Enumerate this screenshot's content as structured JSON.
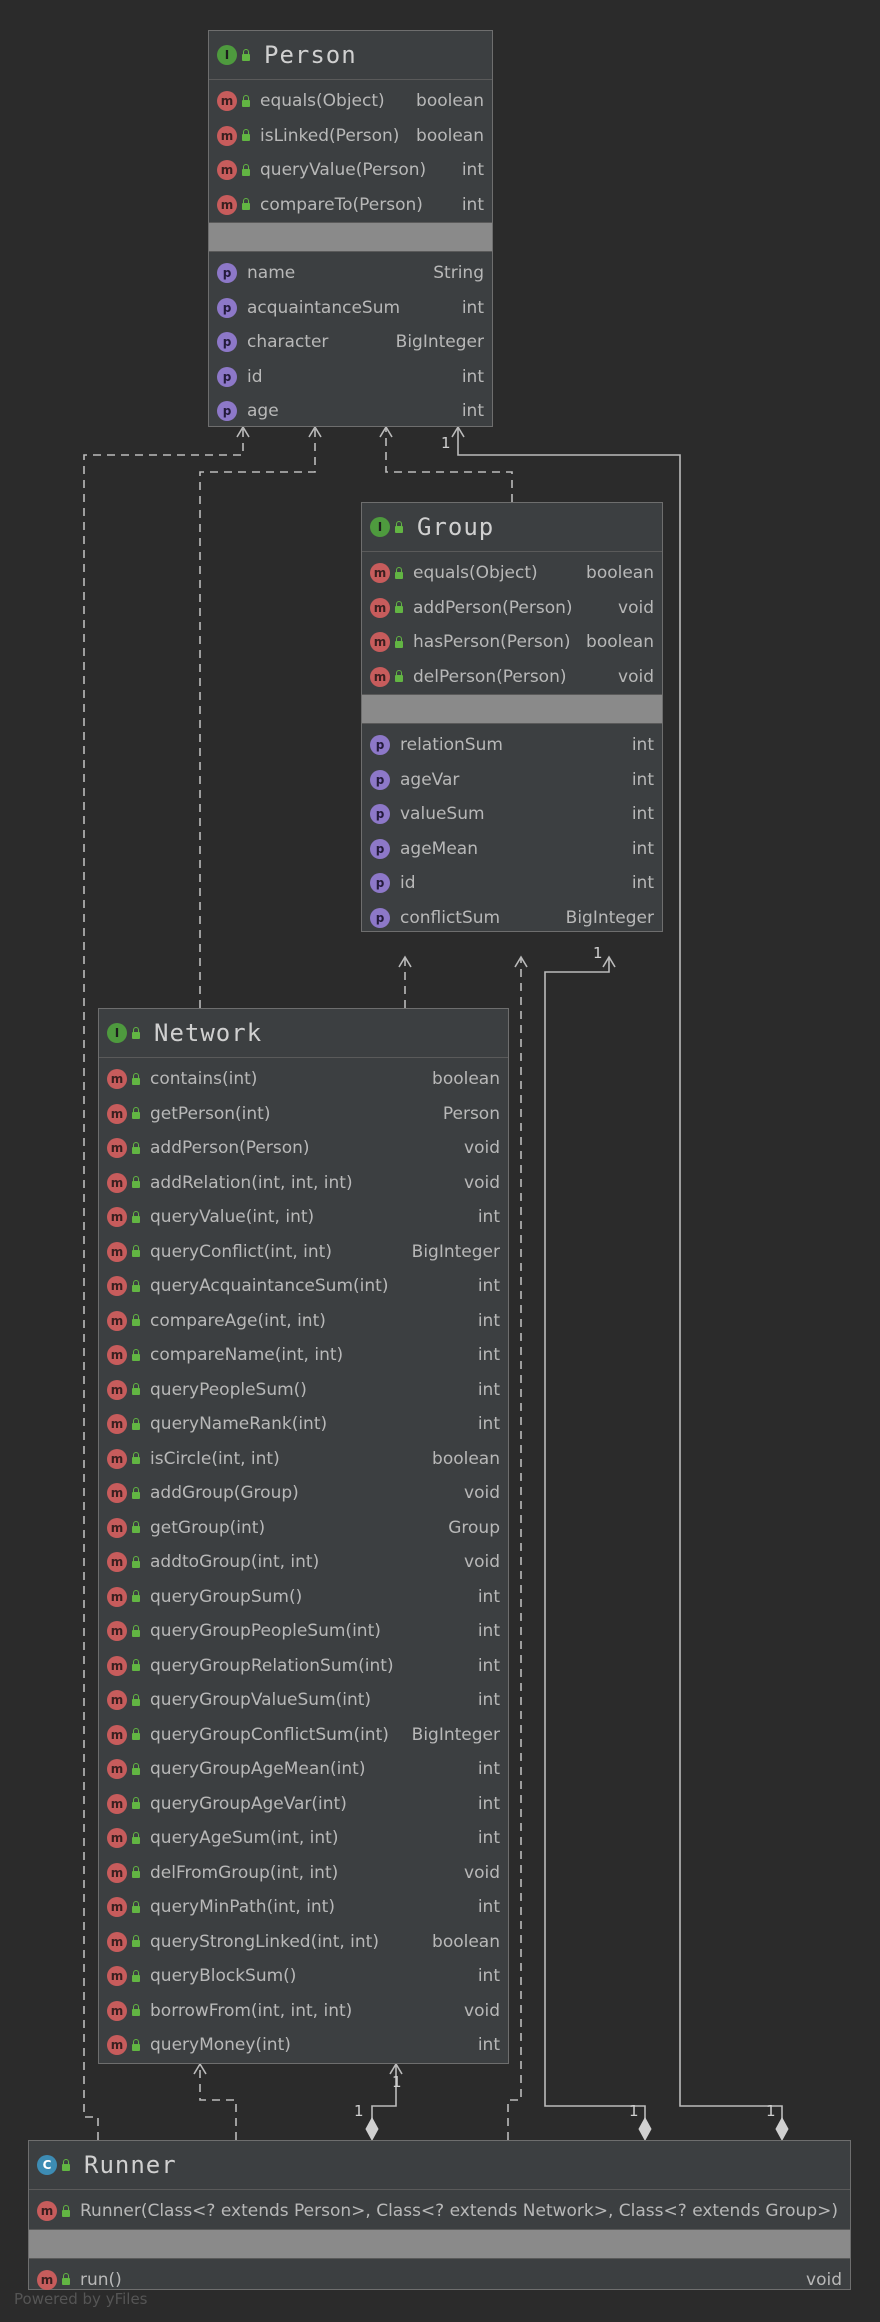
{
  "person": {
    "title": "Person",
    "methods": [
      {
        "name": "equals(Object)",
        "type": "boolean"
      },
      {
        "name": "isLinked(Person)",
        "type": "boolean"
      },
      {
        "name": "queryValue(Person)",
        "type": "int"
      },
      {
        "name": "compareTo(Person)",
        "type": "int"
      }
    ],
    "properties": [
      {
        "name": "name",
        "type": "String"
      },
      {
        "name": "acquaintanceSum",
        "type": "int"
      },
      {
        "name": "character",
        "type": "BigInteger"
      },
      {
        "name": "id",
        "type": "int"
      },
      {
        "name": "age",
        "type": "int"
      }
    ]
  },
  "group": {
    "title": "Group",
    "methods": [
      {
        "name": "equals(Object)",
        "type": "boolean"
      },
      {
        "name": "addPerson(Person)",
        "type": "void"
      },
      {
        "name": "hasPerson(Person)",
        "type": "boolean"
      },
      {
        "name": "delPerson(Person)",
        "type": "void"
      }
    ],
    "properties": [
      {
        "name": "relationSum",
        "type": "int"
      },
      {
        "name": "ageVar",
        "type": "int"
      },
      {
        "name": "valueSum",
        "type": "int"
      },
      {
        "name": "ageMean",
        "type": "int"
      },
      {
        "name": "id",
        "type": "int"
      },
      {
        "name": "conflictSum",
        "type": "BigInteger"
      }
    ]
  },
  "network": {
    "title": "Network",
    "methods": [
      {
        "name": "contains(int)",
        "type": "boolean"
      },
      {
        "name": "getPerson(int)",
        "type": "Person"
      },
      {
        "name": "addPerson(Person)",
        "type": "void"
      },
      {
        "name": "addRelation(int, int, int)",
        "type": "void"
      },
      {
        "name": "queryValue(int, int)",
        "type": "int"
      },
      {
        "name": "queryConflict(int, int)",
        "type": "BigInteger"
      },
      {
        "name": "queryAcquaintanceSum(int)",
        "type": "int"
      },
      {
        "name": "compareAge(int, int)",
        "type": "int"
      },
      {
        "name": "compareName(int, int)",
        "type": "int"
      },
      {
        "name": "queryPeopleSum()",
        "type": "int"
      },
      {
        "name": "queryNameRank(int)",
        "type": "int"
      },
      {
        "name": "isCircle(int, int)",
        "type": "boolean"
      },
      {
        "name": "addGroup(Group)",
        "type": "void"
      },
      {
        "name": "getGroup(int)",
        "type": "Group"
      },
      {
        "name": "addtoGroup(int, int)",
        "type": "void"
      },
      {
        "name": "queryGroupSum()",
        "type": "int"
      },
      {
        "name": "queryGroupPeopleSum(int)",
        "type": "int"
      },
      {
        "name": "queryGroupRelationSum(int)",
        "type": "int"
      },
      {
        "name": "queryGroupValueSum(int)",
        "type": "int"
      },
      {
        "name": "queryGroupConflictSum(int)",
        "type": "BigInteger"
      },
      {
        "name": "queryGroupAgeMean(int)",
        "type": "int"
      },
      {
        "name": "queryGroupAgeVar(int)",
        "type": "int"
      },
      {
        "name": "queryAgeSum(int, int)",
        "type": "int"
      },
      {
        "name": "delFromGroup(int, int)",
        "type": "void"
      },
      {
        "name": "queryMinPath(int, int)",
        "type": "int"
      },
      {
        "name": "queryStrongLinked(int, int)",
        "type": "boolean"
      },
      {
        "name": "queryBlockSum()",
        "type": "int"
      },
      {
        "name": "borrowFrom(int, int, int)",
        "type": "void"
      },
      {
        "name": "queryMoney(int)",
        "type": "int"
      }
    ]
  },
  "runner": {
    "title": "Runner",
    "constructors": [
      {
        "name": "Runner(Class<? extends Person>, Class<? extends Network>, Class<? extends Group>)",
        "type": ""
      }
    ],
    "methods": [
      {
        "name": "run()",
        "type": "void"
      }
    ]
  },
  "badges": {
    "interface": "I",
    "class": "C",
    "method": "m",
    "property": "p"
  },
  "multiplicities": {
    "runner_person": "1",
    "runner_group": "1",
    "runner_network": "1",
    "group_person": "1"
  },
  "footer": "Powered by yFiles",
  "colors": {
    "background": "#2b2b2b",
    "node": "#3c3f41",
    "edge": "#bbbbbb",
    "interface_badge": "#4e9a3e",
    "class_badge": "#3d8cb4",
    "method_badge": "#c75c5c",
    "property_badge": "#8d78c8"
  }
}
